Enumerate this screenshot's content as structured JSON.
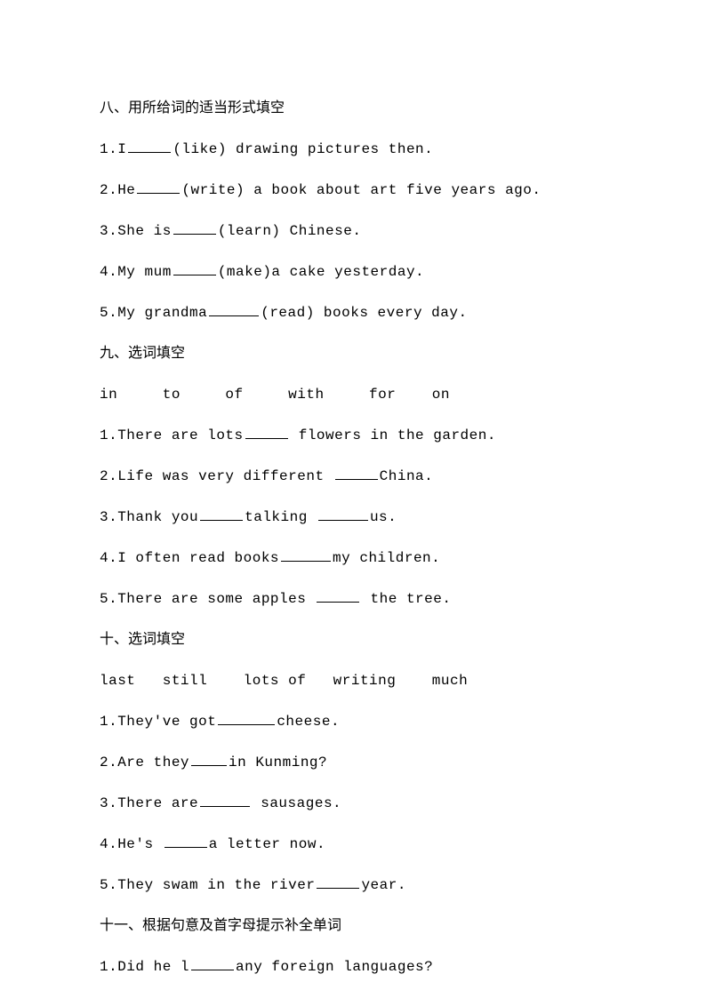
{
  "section8": {
    "heading": "八、用所给词的适当形式填空",
    "items": [
      {
        "prefix": "1.I",
        "hint": "(like) drawing pictures then."
      },
      {
        "prefix": "2.He",
        "hint": "(write) a book about art five years ago."
      },
      {
        "prefix": "3.She is",
        "hint": "(learn) Chinese."
      },
      {
        "prefix": "4.My mum",
        "hint": "(make)a cake yesterday."
      },
      {
        "prefix": "5.My grandma",
        "hint": "(read) books every day."
      }
    ]
  },
  "section9": {
    "heading": "九、选词填空",
    "wordbank": "in     to     of     with     for    on",
    "items": [
      {
        "prefix": "1.There are lots",
        "suffix": " flowers in the garden."
      },
      {
        "prefix": "2.Life was very different ",
        "suffix": "China."
      },
      {
        "prefix": "3.Thank you",
        "mid": "talking ",
        "suffix": "us."
      },
      {
        "prefix": "4.I often read books",
        "suffix": "my children."
      },
      {
        "prefix": "5.There are some apples ",
        "suffix": " the tree."
      }
    ]
  },
  "section10": {
    "heading": "十、选词填空",
    "wordbank": "last   still    lots of   writing    much",
    "items": [
      {
        "prefix": "1.They've got",
        "suffix": "cheese."
      },
      {
        "prefix": "2.Are they",
        "suffix": "in Kunming?"
      },
      {
        "prefix": "3.There are",
        "suffix": " sausages."
      },
      {
        "prefix": "4.He's ",
        "suffix": "a letter now."
      },
      {
        "prefix": "5.They swam in the river",
        "suffix": "year."
      }
    ]
  },
  "section11": {
    "heading": "十一、根据句意及首字母提示补全单词",
    "items": [
      {
        "prefix": "1.Did he l",
        "suffix": "any foreign languages?"
      }
    ]
  }
}
